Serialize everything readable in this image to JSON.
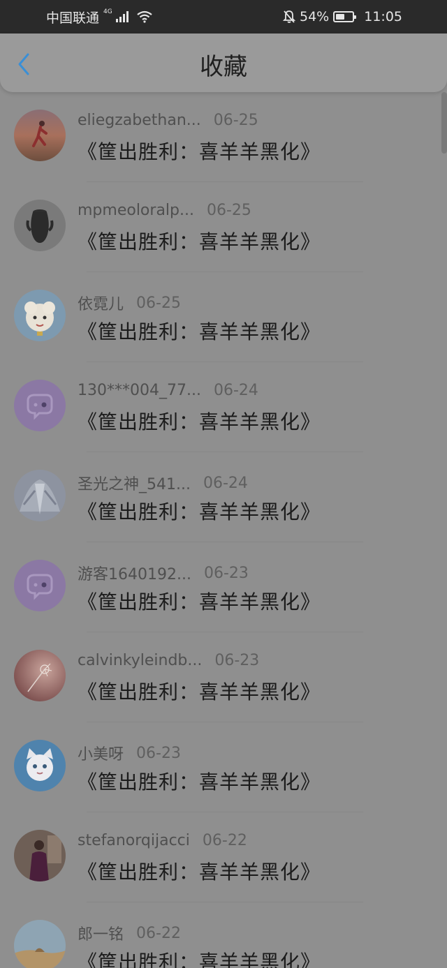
{
  "status_bar": {
    "carrier": "中国联通",
    "network_type": "4G",
    "battery_percent": "54%",
    "battery_level": 0.54,
    "time": "11:05",
    "icons": [
      "signal-icon",
      "wifi-icon",
      "bell-muted-icon",
      "battery-icon"
    ]
  },
  "header": {
    "back_icon": "chevron-left-icon",
    "title": "收藏",
    "accent_color": "#3a8fd6"
  },
  "items": [
    {
      "username": "eliegzabethan...",
      "date": "06-25",
      "title": "《筐出胜利：喜羊羊黑化》",
      "avatar": "runner-photo"
    },
    {
      "username": "mpmeoloralp...",
      "date": "06-25",
      "title": "《筐出胜利：喜羊羊黑化》",
      "avatar": "vase-photo"
    },
    {
      "username": "依霓儿",
      "date": "06-25",
      "title": "《筐出胜利：喜羊羊黑化》",
      "avatar": "cartoon-sheep"
    },
    {
      "username": "130***004_77...",
      "date": "06-24",
      "title": "《筐出胜利：喜羊羊黑化》",
      "avatar": "default-chat-avatar"
    },
    {
      "username": "圣光之神_541...",
      "date": "06-24",
      "title": "《筐出胜利：喜羊羊黑化》",
      "avatar": "angel-photo"
    },
    {
      "username": "游客1640192...",
      "date": "06-23",
      "title": "《筐出胜利：喜羊羊黑化》",
      "avatar": "default-chat-avatar"
    },
    {
      "username": "calvinkyleindb...",
      "date": "06-23",
      "title": "《筐出胜利：喜羊羊黑化》",
      "avatar": "dandelion-photo"
    },
    {
      "username": "小美呀",
      "date": "06-23",
      "title": "《筐出胜利：喜羊羊黑化》",
      "avatar": "cartoon-cat"
    },
    {
      "username": "stefanorqijacci",
      "date": "06-22",
      "title": "《筐出胜利：喜羊羊黑化》",
      "avatar": "woman-photo"
    },
    {
      "username": "郎一铭",
      "date": "06-22",
      "title": "《筐出胜利：喜羊羊黑化》",
      "avatar": "desert-photo"
    }
  ]
}
